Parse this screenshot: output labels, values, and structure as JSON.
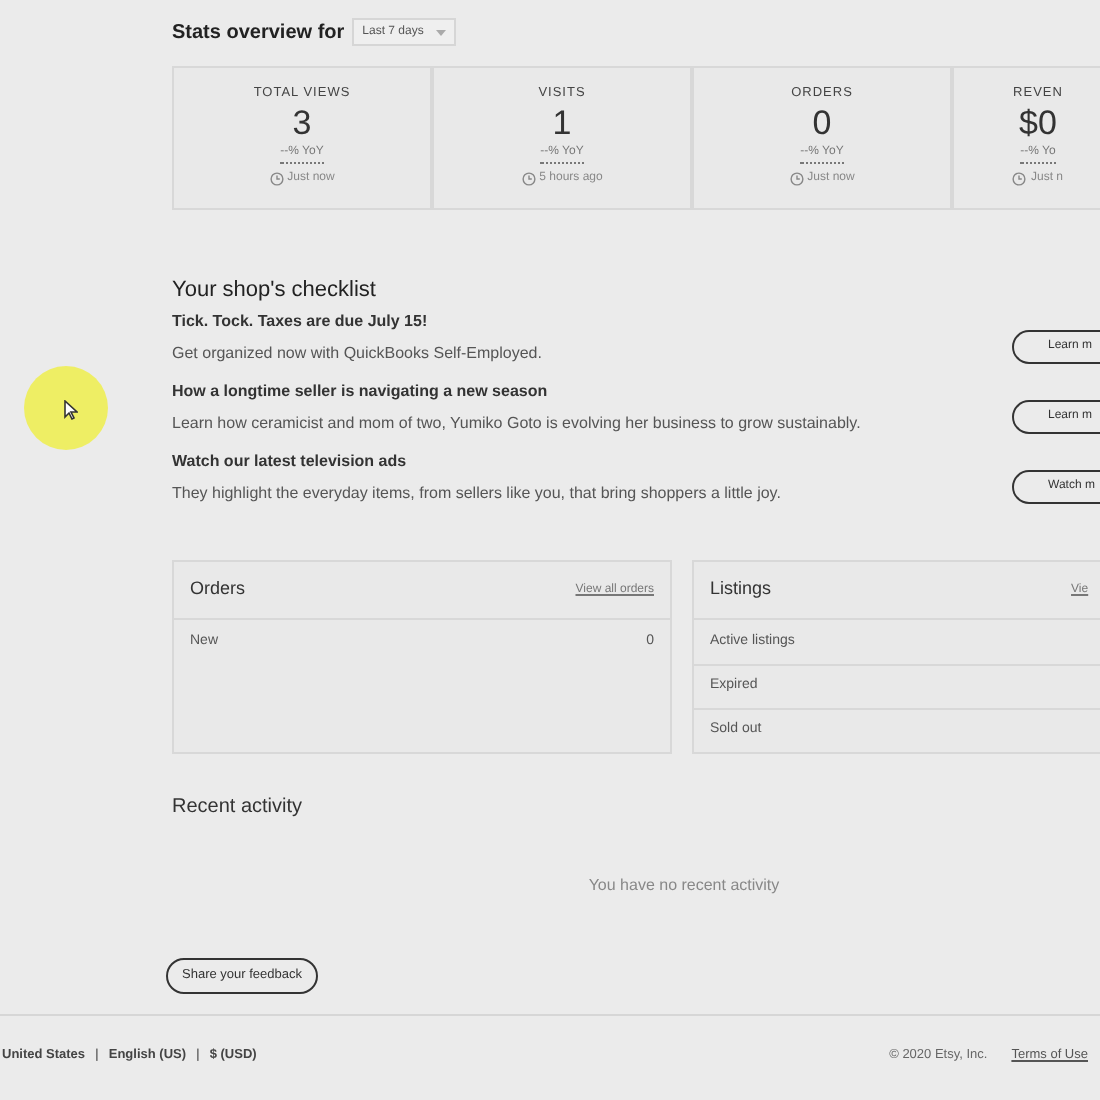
{
  "stats_header": {
    "title": "Stats overview for",
    "range": "Last 7 days"
  },
  "stats": [
    {
      "label": "TOTAL VIEWS",
      "value": "3",
      "change": "--% YoY",
      "updated": "Just now"
    },
    {
      "label": "VISITS",
      "value": "1",
      "change": "--% YoY",
      "updated": "5 hours ago"
    },
    {
      "label": "ORDERS",
      "value": "0",
      "change": "--% YoY",
      "updated": "Just now"
    },
    {
      "label": "REVEN",
      "value": "$0",
      "change": "--% Yo",
      "updated": "Just n"
    }
  ],
  "checklist": {
    "title": "Your shop's checklist",
    "items": [
      {
        "heading": "Tick. Tock. Taxes are due July 15!",
        "text": "Get organized now with QuickBooks Self-Employed.",
        "button": "Learn m"
      },
      {
        "heading": "How a longtime seller is navigating a new season",
        "text": "Learn how ceramicist and mom of two, Yumiko Goto is evolving her business to grow sustainably.",
        "button": "Learn m"
      },
      {
        "heading": "Watch our latest television ads",
        "text": "They highlight the everyday items, from sellers like you, that bring shoppers a little joy.",
        "button": "Watch m"
      }
    ]
  },
  "orders": {
    "title": "Orders",
    "link": "View all orders",
    "rows": [
      {
        "label": "New",
        "value": "0"
      }
    ]
  },
  "listings": {
    "title": "Listings",
    "link": "Vie",
    "rows": [
      {
        "label": "Active listings"
      },
      {
        "label": "Expired"
      },
      {
        "label": "Sold out"
      }
    ]
  },
  "recent_activity": {
    "title": "Recent activity",
    "empty": "You have no recent activity"
  },
  "feedback_button": "Share your feedback",
  "footer": {
    "region": "United States",
    "language": "English (US)",
    "currency": "$ (USD)",
    "separator": "|",
    "copyright": "© 2020 Etsy, Inc.",
    "terms": "Terms of Use"
  }
}
